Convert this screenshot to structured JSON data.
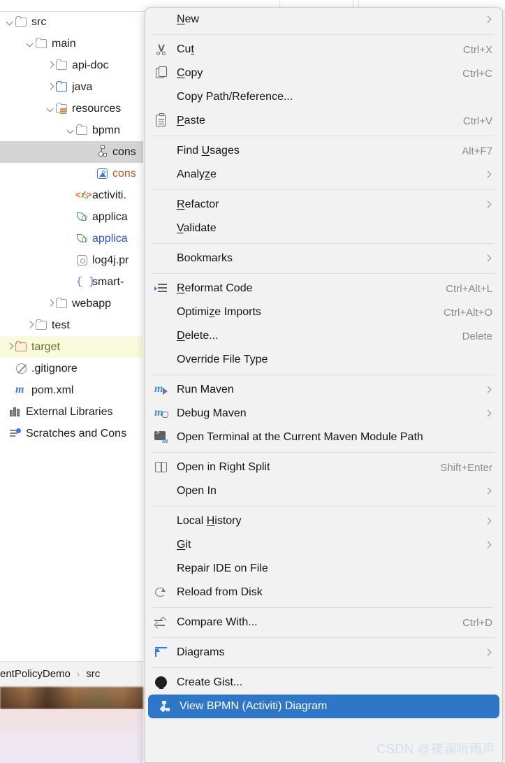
{
  "tree": [
    {
      "label": "src",
      "indent": 0,
      "arrow": "down",
      "icon": "folder",
      "color": "default"
    },
    {
      "label": "main",
      "indent": 1,
      "arrow": "down",
      "icon": "folder",
      "color": "default"
    },
    {
      "label": "api-doc",
      "indent": 2,
      "arrow": "right",
      "icon": "folder",
      "color": "default"
    },
    {
      "label": "java",
      "indent": 2,
      "arrow": "right",
      "icon": "folder-source",
      "color": "default"
    },
    {
      "label": "resources",
      "indent": 2,
      "arrow": "down",
      "icon": "folder-resources",
      "color": "default"
    },
    {
      "label": "bpmn",
      "indent": 3,
      "arrow": "down",
      "icon": "folder",
      "color": "default"
    },
    {
      "label": "cons",
      "indent": 4,
      "arrow": "none",
      "icon": "bpmn-file",
      "color": "default",
      "selected": true
    },
    {
      "label": "cons",
      "indent": 4,
      "arrow": "none",
      "icon": "image-file",
      "color": "orange"
    },
    {
      "label": "activiti.",
      "indent": 3,
      "arrow": "none",
      "icon": "xml-file",
      "color": "default"
    },
    {
      "label": "applica",
      "indent": 3,
      "arrow": "none",
      "icon": "spring-file",
      "color": "default"
    },
    {
      "label": "applica",
      "indent": 3,
      "arrow": "none",
      "icon": "spring-file",
      "color": "blue"
    },
    {
      "label": "log4j.pr",
      "indent": 3,
      "arrow": "none",
      "icon": "properties-file",
      "color": "default"
    },
    {
      "label": "smart-",
      "indent": 3,
      "arrow": "none",
      "icon": "json-file",
      "color": "default"
    },
    {
      "label": "webapp",
      "indent": 2,
      "arrow": "right",
      "icon": "folder",
      "color": "default"
    },
    {
      "label": "test",
      "indent": 1,
      "arrow": "right",
      "icon": "folder",
      "color": "default"
    },
    {
      "label": "target",
      "indent": 0,
      "arrow": "right",
      "icon": "folder-excluded",
      "color": "olive",
      "target": true
    },
    {
      "label": ".gitignore",
      "indent": 0,
      "arrow": "none",
      "icon": "gitignore-file",
      "color": "default"
    },
    {
      "label": "pom.xml",
      "indent": 0,
      "arrow": "none",
      "icon": "maven-file",
      "color": "default"
    },
    {
      "label": "External Libraries",
      "indent": -1,
      "arrow": "none",
      "icon": "libraries",
      "color": "default"
    },
    {
      "label": "Scratches and Cons",
      "indent": -1,
      "arrow": "none",
      "icon": "scratches",
      "color": "default"
    }
  ],
  "breadcrumb": {
    "project": "entPolicyDemo",
    "separator": "›",
    "folder": "src"
  },
  "menu": {
    "items": [
      {
        "type": "item",
        "label": "New",
        "mnemonic": "N",
        "icon": "none",
        "submenu": true
      },
      {
        "type": "separator"
      },
      {
        "type": "item",
        "label": "Cut",
        "mnemonic": "t",
        "icon": "scissors-icon",
        "shortcut": "Ctrl+X"
      },
      {
        "type": "item",
        "label": "Copy",
        "mnemonic": "C",
        "icon": "copy-icon",
        "shortcut": "Ctrl+C"
      },
      {
        "type": "item",
        "label": "Copy Path/Reference...",
        "icon": "none"
      },
      {
        "type": "item",
        "label": "Paste",
        "mnemonic": "P",
        "icon": "paste-icon",
        "shortcut": "Ctrl+V"
      },
      {
        "type": "separator"
      },
      {
        "type": "item",
        "label": "Find Usages",
        "mnemonic": "U",
        "icon": "none",
        "shortcut": "Alt+F7"
      },
      {
        "type": "item",
        "label": "Analyze",
        "mnemonic": "z",
        "icon": "none",
        "submenu": true
      },
      {
        "type": "separator"
      },
      {
        "type": "item",
        "label": "Refactor",
        "mnemonic": "R",
        "icon": "none",
        "submenu": true
      },
      {
        "type": "item",
        "label": "Validate",
        "mnemonic": "V",
        "icon": "none"
      },
      {
        "type": "separator"
      },
      {
        "type": "item",
        "label": "Bookmarks",
        "icon": "none",
        "submenu": true
      },
      {
        "type": "separator"
      },
      {
        "type": "item",
        "label": "Reformat Code",
        "mnemonic": "R",
        "icon": "reformat-icon",
        "shortcut": "Ctrl+Alt+L"
      },
      {
        "type": "item",
        "label": "Optimize Imports",
        "mnemonic": "z",
        "icon": "none",
        "shortcut": "Ctrl+Alt+O"
      },
      {
        "type": "item",
        "label": "Delete...",
        "mnemonic": "D",
        "icon": "none",
        "shortcut": "Delete"
      },
      {
        "type": "item",
        "label": "Override File Type",
        "icon": "none"
      },
      {
        "type": "separator"
      },
      {
        "type": "item",
        "label": "Run Maven",
        "icon": "maven-run-icon",
        "submenu": true
      },
      {
        "type": "item",
        "label": "Debug Maven",
        "icon": "maven-debug-icon",
        "submenu": true
      },
      {
        "type": "item",
        "label": "Open Terminal at the Current Maven Module Path",
        "icon": "terminal-maven-icon"
      },
      {
        "type": "separator"
      },
      {
        "type": "item",
        "label": "Open in Right Split",
        "icon": "split-icon",
        "shortcut": "Shift+Enter"
      },
      {
        "type": "item",
        "label": "Open In",
        "icon": "none",
        "submenu": true
      },
      {
        "type": "separator"
      },
      {
        "type": "item",
        "label": "Local History",
        "mnemonic": "H",
        "icon": "none",
        "submenu": true
      },
      {
        "type": "item",
        "label": "Git",
        "mnemonic": "G",
        "icon": "none",
        "submenu": true
      },
      {
        "type": "item",
        "label": "Repair IDE on File",
        "icon": "none"
      },
      {
        "type": "item",
        "label": "Reload from Disk",
        "icon": "reload-icon"
      },
      {
        "type": "separator"
      },
      {
        "type": "item",
        "label": "Compare With...",
        "icon": "compare-icon",
        "shortcut": "Ctrl+D"
      },
      {
        "type": "separator"
      },
      {
        "type": "item",
        "label": "Diagrams",
        "icon": "diagrams-icon",
        "submenu": true
      },
      {
        "type": "separator"
      },
      {
        "type": "item",
        "label": "Create Gist...",
        "icon": "github-icon"
      },
      {
        "type": "item",
        "label": "View BPMN (Activiti) Diagram",
        "icon": "bpmn-icon",
        "highlight": true
      }
    ]
  },
  "watermark": "CSDN @夜澜听雨声",
  "colors": {
    "menu_bg": "#f2f2f2",
    "highlight": "#2e76c8",
    "selection": "#d4d4d4",
    "target_row": "#fafadc",
    "accent_blue": "#3574f0",
    "accent_orange": "#e8833a"
  }
}
